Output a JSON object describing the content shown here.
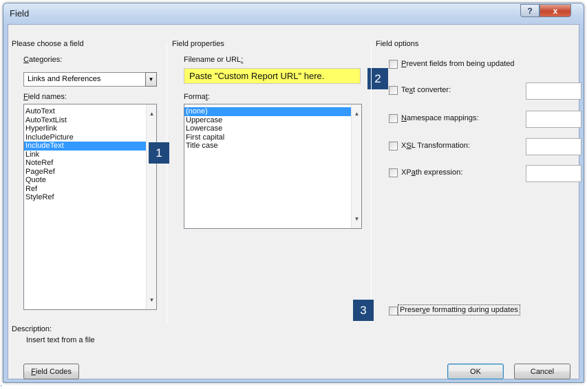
{
  "window": {
    "title": "Field",
    "help_glyph": "?",
    "close_glyph": "x"
  },
  "left": {
    "group_label": "Please choose a field",
    "categories_label_pre": "",
    "categories_label_ul": "C",
    "categories_label_post": "ategories:",
    "category_value": "Links and References",
    "field_names_label_pre": "",
    "field_names_label_ul": "F",
    "field_names_label_post": "ield names:",
    "field_names": [
      "AutoText",
      "AutoTextList",
      "Hyperlink",
      "IncludePicture",
      "IncludeText",
      "Link",
      "NoteRef",
      "PageRef",
      "Quote",
      "Ref",
      "StyleRef"
    ],
    "description_label": "Description:",
    "description_text": "Insert text from a file"
  },
  "middle": {
    "group_label": "Field properties",
    "url_label_pre": "Filename or URL",
    "url_label_ul": ":",
    "url_value": "Paste \"Custom Report URL\" here.",
    "format_label_pre": "Forma",
    "format_label_ul": "t",
    "format_label_post": ":",
    "formats": [
      "(none)",
      "Uppercase",
      "Lowercase",
      "First capital",
      "Title case"
    ]
  },
  "right": {
    "group_label": "Field options",
    "prevent_pre": "",
    "prevent_ul": "P",
    "prevent_post": "revent fields from being updated",
    "text_converter_pre": "Te",
    "text_converter_ul": "x",
    "text_converter_post": "t converter:",
    "namespace_pre": "",
    "namespace_ul": "N",
    "namespace_post": "amespace mappings:",
    "xsl_pre": "X",
    "xsl_ul": "S",
    "xsl_post": "L Transformation:",
    "xpath_pre": "XP",
    "xpath_ul": "a",
    "xpath_post": "th expression:",
    "preserve_pre": "Preser",
    "preserve_ul": "v",
    "preserve_post": "e formatting during updates"
  },
  "badges": {
    "one": "1",
    "two": "2",
    "three": "3"
  },
  "buttons": {
    "field_codes_ul": "F",
    "field_codes_post": "ield Codes",
    "ok": "OK",
    "cancel": "Cancel"
  },
  "stray_mark": ":"
}
